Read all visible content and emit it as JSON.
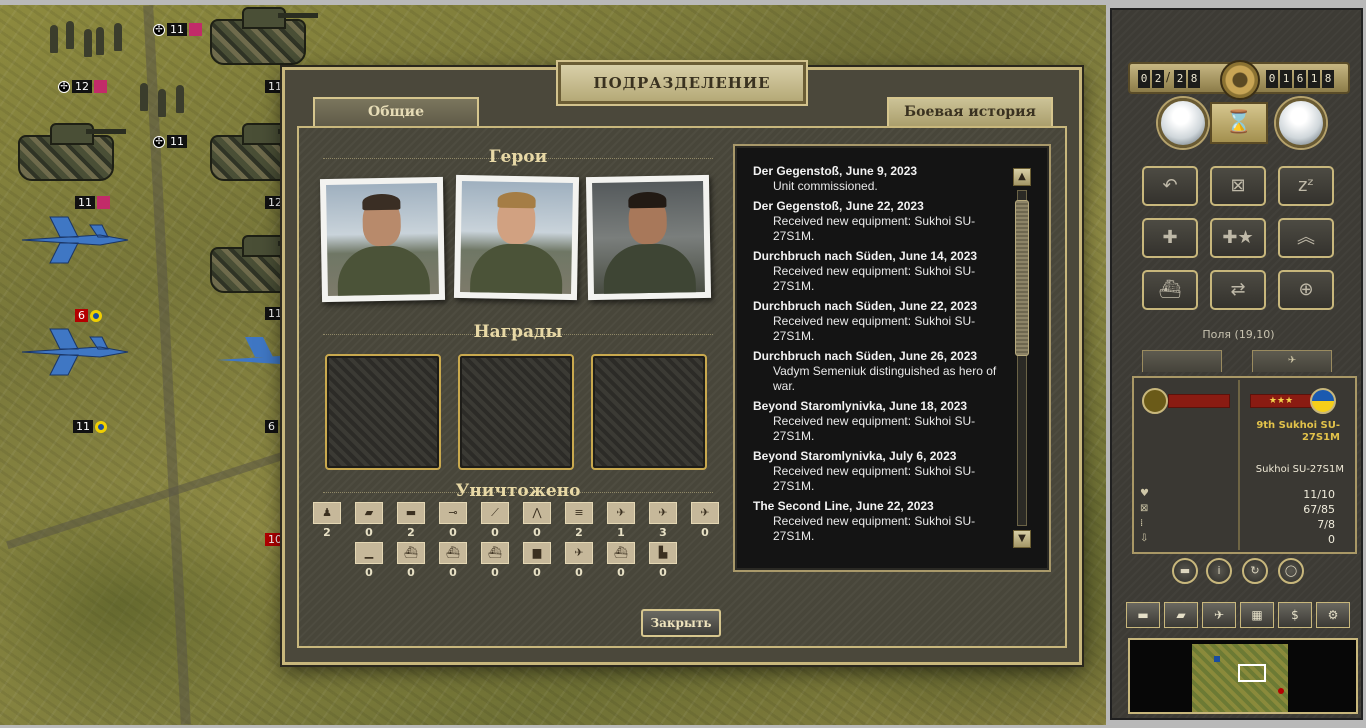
{
  "dialog": {
    "title": "ПОДРАЗДЕЛЕНИЕ",
    "tabs": [
      {
        "label": "Общие",
        "active": false
      },
      {
        "label": "Боевая история",
        "active": true
      }
    ],
    "heroes_title": "Герои",
    "awards_title": "Награды",
    "destroyed_title": "Уничтожено",
    "close_label": "Закрыть"
  },
  "kills_row1": [
    {
      "icon": "infantry-icon",
      "count": "2"
    },
    {
      "icon": "tank-icon",
      "count": "0"
    },
    {
      "icon": "recon-vehicle-icon",
      "count": "2"
    },
    {
      "icon": "anti-tank-gun-icon",
      "count": "0"
    },
    {
      "icon": "artillery-icon",
      "count": "0"
    },
    {
      "icon": "anti-air-icon",
      "count": "0"
    },
    {
      "icon": "rocket-launcher-icon",
      "count": "2"
    },
    {
      "icon": "fighter-icon",
      "count": "1"
    },
    {
      "icon": "bomber-icon",
      "count": "3"
    },
    {
      "icon": "helicopter-icon",
      "count": "0"
    }
  ],
  "kills_row2": [
    {
      "icon": "submarine-icon",
      "count": "0"
    },
    {
      "icon": "destroyer-icon",
      "count": "0"
    },
    {
      "icon": "cruiser-icon",
      "count": "0"
    },
    {
      "icon": "battleship-icon",
      "count": "0"
    },
    {
      "icon": "transport-truck-icon",
      "count": "0"
    },
    {
      "icon": "transport-plane-icon",
      "count": "0"
    },
    {
      "icon": "landing-craft-icon",
      "count": "0"
    },
    {
      "icon": "fortification-icon",
      "count": "0"
    }
  ],
  "history": [
    {
      "head": "Der Gegenstoß, June 9, 2023",
      "text": "Unit commissioned."
    },
    {
      "head": "Der Gegenstoß, June 22, 2023",
      "text": "Received new equipment: Sukhoi SU-27S1M."
    },
    {
      "head": "Durchbruch nach Süden, June 14, 2023",
      "text": "Received new equipment: Sukhoi SU-27S1M."
    },
    {
      "head": "Durchbruch nach Süden, June 22, 2023",
      "text": "Received new equipment: Sukhoi SU-27S1M."
    },
    {
      "head": "Durchbruch nach Süden, June 26, 2023",
      "text": "Vadym Semeniuk distinguished as hero of war."
    },
    {
      "head": "Beyond Staromlynivka, June 18, 2023",
      "text": "Received new equipment: Sukhoi SU-27S1M."
    },
    {
      "head": "Beyond Staromlynivka, July 6, 2023",
      "text": "Received new equipment: Sukhoi SU-27S1M."
    },
    {
      "head": "The Second Line, June 22, 2023",
      "text": "Received new equipment: Sukhoi SU-27S1M."
    }
  ],
  "map_badges": [
    "11",
    "12",
    "11",
    "11",
    "6",
    "11",
    "12",
    "11",
    "11",
    "6",
    "10"
  ],
  "hud": {
    "turn": [
      "0",
      "2",
      "2",
      "8"
    ],
    "turn_sep": "/",
    "score": [
      "0",
      "1",
      "6",
      "1",
      "8"
    ],
    "coords": "Поля (19,10)",
    "unit_name": "9th Sukhoi SU-27S1M",
    "unit_type": "Sukhoi SU-27S1M",
    "stats": {
      "strength": "11/10",
      "fuel": "67/85",
      "ammo": "7/8",
      "entrench": "0"
    }
  },
  "colors": {
    "accent": "#c8b77c",
    "panel": "#48463a",
    "title_text": "#3a3220",
    "unit_name": "#e2c24a"
  }
}
